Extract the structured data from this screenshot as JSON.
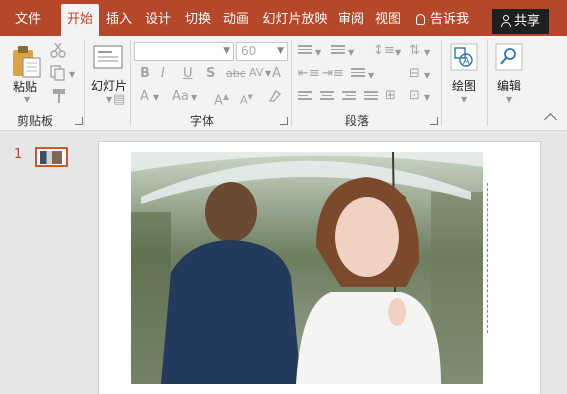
{
  "tabs": [
    {
      "label": "文件",
      "active": false
    },
    {
      "label": "开始",
      "active": true
    },
    {
      "label": "插入",
      "active": false
    },
    {
      "label": "设计",
      "active": false
    },
    {
      "label": "切换",
      "active": false
    },
    {
      "label": "动画",
      "active": false
    },
    {
      "label": "幻灯片放映",
      "active": false
    },
    {
      "label": "审阅",
      "active": false
    },
    {
      "label": "视图",
      "active": false
    }
  ],
  "tell_me": "告诉我",
  "share_label": "共享",
  "groups": {
    "clipboard": {
      "label": "剪贴板",
      "paste_label": "粘贴"
    },
    "slides": {
      "new_slide_label": "幻灯片"
    },
    "font": {
      "label": "字体",
      "size_value": "60",
      "font_value": ""
    },
    "paragraph": {
      "label": "段落"
    },
    "drawing": {
      "label": "绘图"
    },
    "editing": {
      "label": "编辑"
    }
  },
  "font_buttons": [
    "B",
    "I",
    "U",
    "S",
    "abc",
    "AV"
  ],
  "thumbnail_number": "1",
  "colors": {
    "accent": "#b7472a",
    "ribbon": "#f3f3f3",
    "share_bg": "#1f1f1f",
    "workspace": "#e6e6e6",
    "thumb_border": "#d0562b"
  }
}
